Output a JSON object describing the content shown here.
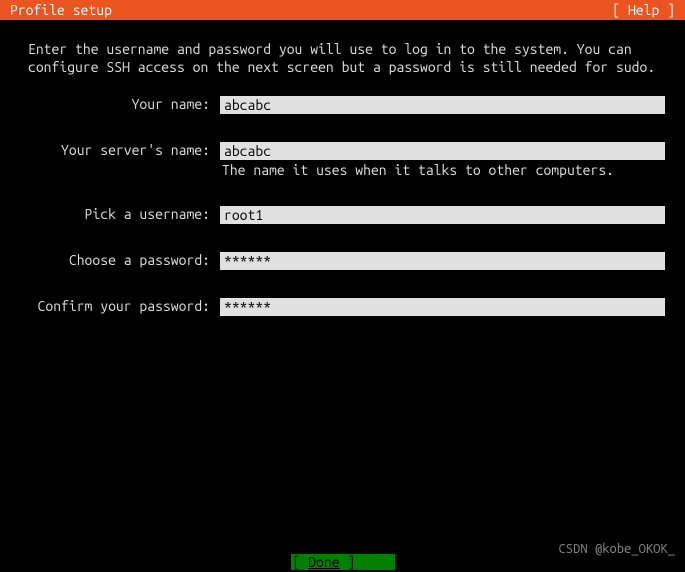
{
  "header": {
    "title": "Profile setup",
    "help": "[ Help ]"
  },
  "description": "Enter the username and password you will use to log in to the system. You can configure SSH access on the next screen but a password is still needed for sudo.",
  "form": {
    "name": {
      "label": "Your name:",
      "value": "abcabc"
    },
    "server_name": {
      "label": "Your server's name:",
      "value": "abcabc",
      "hint": "The name it uses when it talks to other computers."
    },
    "username": {
      "label": "Pick a username:",
      "value": "root1"
    },
    "password": {
      "label": "Choose a password:",
      "value": "******"
    },
    "confirm_password": {
      "label": "Confirm your password:",
      "value": "******"
    }
  },
  "footer": {
    "done_prefix": "[ ",
    "done_label": "Done",
    "done_suffix": "     ]"
  },
  "watermark": "CSDN @kobe_OKOK_"
}
